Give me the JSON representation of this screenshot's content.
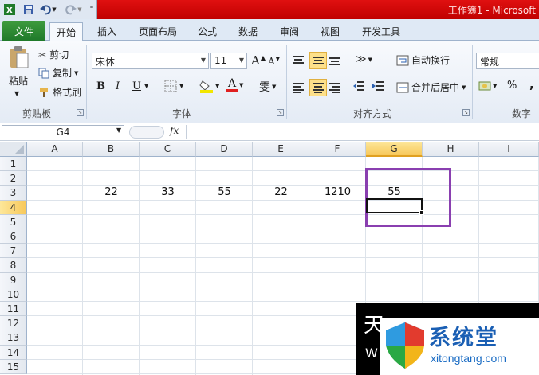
{
  "window": {
    "title": "工作簿1 - Microsoft"
  },
  "tabs": [
    "文件",
    "开始",
    "插入",
    "页面布局",
    "公式",
    "数据",
    "审阅",
    "视图",
    "开发工具"
  ],
  "ribbon": {
    "clipboard": {
      "paste": "粘贴",
      "cut": "剪切",
      "copy": "复制",
      "format_painter": "格式刷",
      "label": "剪贴板"
    },
    "font": {
      "name": "宋体",
      "size": "11",
      "bold": "B",
      "italic": "I",
      "underline": "U",
      "grow": "A",
      "shrink": "A",
      "phonetic": "雯",
      "label": "字体"
    },
    "alignment": {
      "wrap_text": "自动换行",
      "merge_center": "合并后居中",
      "label": "对齐方式"
    },
    "number": {
      "format": "常规",
      "percent": "%",
      "comma": ",",
      "label": "数字"
    },
    "colors": {
      "fill": "#f2e600",
      "font": "#e02020",
      "file_tab": "#2a8a2f",
      "highlight": "#8a3fb0",
      "title_bar": "#d00000"
    }
  },
  "formula_bar": {
    "name_box": "G4",
    "fx": "fx",
    "value": ""
  },
  "sheet": {
    "columns": [
      "A",
      "B",
      "C",
      "D",
      "E",
      "F",
      "G",
      "H",
      "I"
    ],
    "rows": [
      "1",
      "2",
      "3",
      "4",
      "5",
      "6",
      "7",
      "8",
      "9",
      "10",
      "11",
      "12",
      "13",
      "14",
      "15"
    ],
    "selected_column": "G",
    "selected_row": "4",
    "row3_values": {
      "B": "22",
      "C": "33",
      "D": "55",
      "E": "22",
      "F": "1210",
      "G": "55"
    }
  },
  "watermark": {
    "title": "系统堂",
    "url": "xitongtang.com",
    "left_glyph": "天",
    "left_letter": "W"
  }
}
